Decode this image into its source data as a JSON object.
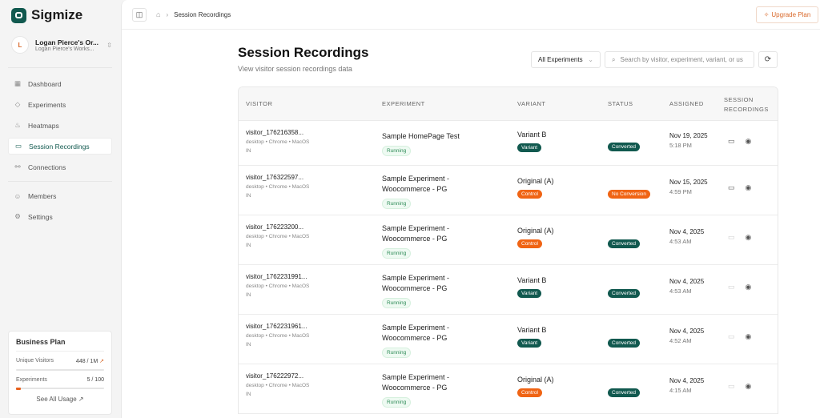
{
  "app": {
    "name": "Sigmize"
  },
  "org": {
    "initial": "L",
    "name": "Logan Pierce's Or...",
    "workspace": "Logan Pierce's Works..."
  },
  "nav": [
    {
      "label": "Dashboard",
      "icon": "dashboard-icon"
    },
    {
      "label": "Experiments",
      "icon": "experiments-icon"
    },
    {
      "label": "Heatmaps",
      "icon": "heatmaps-icon"
    },
    {
      "label": "Session Recordings",
      "icon": "video-icon"
    },
    {
      "label": "Connections",
      "icon": "connections-icon"
    },
    {
      "label": "Members",
      "icon": "members-icon"
    },
    {
      "label": "Settings",
      "icon": "settings-icon"
    }
  ],
  "plan": {
    "title": "Business Plan",
    "visitors_label": "Unique Visitors",
    "visitors_value": "448 / 1M",
    "visitors_pct": 0.04,
    "experiments_label": "Experiments",
    "experiments_value": "5 / 100",
    "experiments_pct": 5,
    "see_all": "See All Usage ↗"
  },
  "header": {
    "breadcrumb": "Session Recordings",
    "upgrade": "Upgrade Plan"
  },
  "page": {
    "title": "Session Recordings",
    "subtitle": "View visitor session recordings data",
    "filter": "All Experiments",
    "search_placeholder": "Search by visitor, experiment, variant, or us"
  },
  "colors": {
    "brand": "#11594f",
    "control": "#f06414",
    "accent": "#d9692b"
  },
  "table": {
    "headers": {
      "visitor": "VISITOR",
      "experiment": "EXPERIMENT",
      "variant": "VARIANT",
      "status": "STATUS",
      "assigned": "ASSIGNED",
      "rec1": "SESSION",
      "rec2": "RECORDINGS"
    },
    "rows": [
      {
        "visitor": "visitor_176216358...",
        "meta": "desktop • Chrome • MacOS",
        "country": "IN",
        "experiment": "Sample HomePage Test",
        "exp_status": "Running",
        "variant": "Variant B",
        "variant_tag": "Variant",
        "status": "Converted",
        "date": "Nov 19, 2025",
        "time": "5:18 PM",
        "has_recording": true
      },
      {
        "visitor": "visitor_176322597...",
        "meta": "desktop • Chrome • MacOS",
        "country": "IN",
        "experiment": "Sample Experiment - Woocommerce - PG",
        "exp_status": "Running",
        "variant": "Original (A)",
        "variant_tag": "Control",
        "status": "No Conversion",
        "date": "Nov 15, 2025",
        "time": "4:59 PM",
        "has_recording": true
      },
      {
        "visitor": "visitor_176223200...",
        "meta": "desktop • Chrome • MacOS",
        "country": "IN",
        "experiment": "Sample Experiment - Woocommerce - PG",
        "exp_status": "Running",
        "variant": "Original (A)",
        "variant_tag": "Control",
        "status": "Converted",
        "date": "Nov 4, 2025",
        "time": "4:53 AM",
        "has_recording": false
      },
      {
        "visitor": "visitor_1762231991...",
        "meta": "desktop • Chrome • MacOS",
        "country": "IN",
        "experiment": "Sample Experiment - Woocommerce - PG",
        "exp_status": "Running",
        "variant": "Variant B",
        "variant_tag": "Variant",
        "status": "Converted",
        "date": "Nov 4, 2025",
        "time": "4:53 AM",
        "has_recording": false
      },
      {
        "visitor": "visitor_1762231961...",
        "meta": "desktop • Chrome • MacOS",
        "country": "IN",
        "experiment": "Sample Experiment - Woocommerce - PG",
        "exp_status": "Running",
        "variant": "Variant B",
        "variant_tag": "Variant",
        "status": "Converted",
        "date": "Nov 4, 2025",
        "time": "4:52 AM",
        "has_recording": false
      },
      {
        "visitor": "visitor_176222972...",
        "meta": "desktop • Chrome • MacOS",
        "country": "IN",
        "experiment": "Sample Experiment - Woocommerce - PG",
        "exp_status": "Running",
        "variant": "Original (A)",
        "variant_tag": "Control",
        "status": "Converted",
        "date": "Nov 4, 2025",
        "time": "4:15 AM",
        "has_recording": false
      }
    ]
  }
}
